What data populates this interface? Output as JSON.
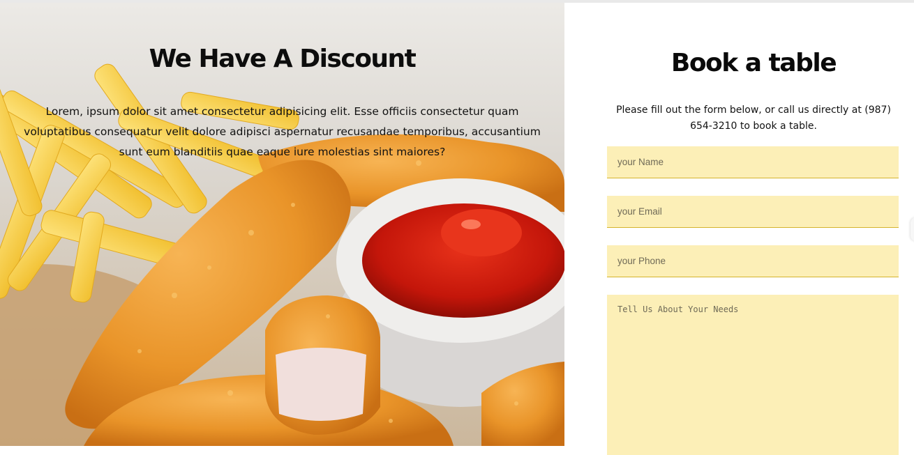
{
  "discount": {
    "title": "We Have A Discount",
    "text": "Lorem, ipsum dolor sit amet consectetur adipisicing elit. Esse officiis consectetur quam voluptatibus consequatur velit dolore adipisci aspernatur recusandae temporibus, accusantium sunt eum blanditiis quae eaque iure molestias sint maiores?",
    "image": "chicken-tenders-fries-ketchup-photo"
  },
  "booking": {
    "title": "Book a table",
    "text": "Please fill out the form below, or call us directly at (987) 654-3210 to book a table.",
    "fields": {
      "name": {
        "placeholder": "your Name",
        "value": ""
      },
      "email": {
        "placeholder": "your Email",
        "value": ""
      },
      "phone": {
        "placeholder": "your Phone",
        "value": ""
      },
      "needs": {
        "placeholder": "Tell Us About Your Needs",
        "value": ""
      }
    }
  },
  "colors": {
    "field_background": "#fcefb7",
    "field_underline": "#d4b32c",
    "heading": "#0d0d0d"
  }
}
